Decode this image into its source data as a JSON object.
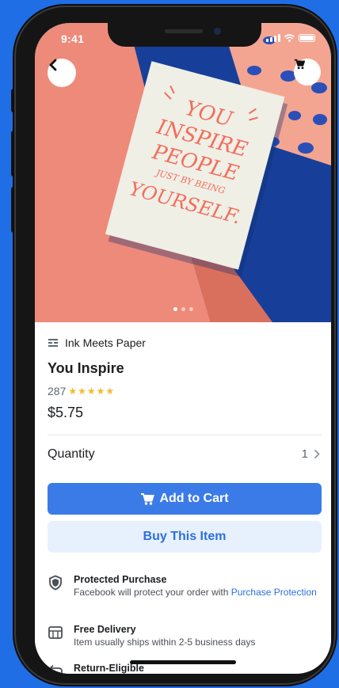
{
  "status_bar": {
    "time": "9:41"
  },
  "hero": {
    "card_lines": [
      "YOU",
      "INSPIRE",
      "PEOPLE",
      "JUST BY BEING",
      "YOURSELF."
    ],
    "page_count": 3,
    "active_page": 1
  },
  "product": {
    "seller": "Ink Meets Paper",
    "title": "You Inspire",
    "rating_count": "287",
    "stars": "★★★★★",
    "rating": 5,
    "price": "$5.75"
  },
  "quantity": {
    "label": "Quantity",
    "value": "1"
  },
  "actions": {
    "add_to_cart": "Add to Cart",
    "buy": "Buy This Item"
  },
  "info": {
    "protected_title": "Protected Purchase",
    "protected_desc": "Facebook will protect your order with ",
    "protected_link": "Purchase Protection",
    "delivery_title": "Free Delivery",
    "delivery_desc": "Item usually ships within 2-5 business days",
    "return_title": "Return-Eligible"
  },
  "colors": {
    "accent": "#3b7be8",
    "accent_light": "#e7f0fd",
    "star": "#f7b928",
    "background": "#1f6ee6",
    "card_ink": "#f26d5b",
    "salmon": "#ee8a7a",
    "navy": "#173f9a"
  },
  "icons": [
    "back-arrow-icon",
    "cart-icon",
    "store-icon",
    "shield-icon",
    "delivery-icon",
    "return-icon",
    "chevron-right-icon"
  ]
}
